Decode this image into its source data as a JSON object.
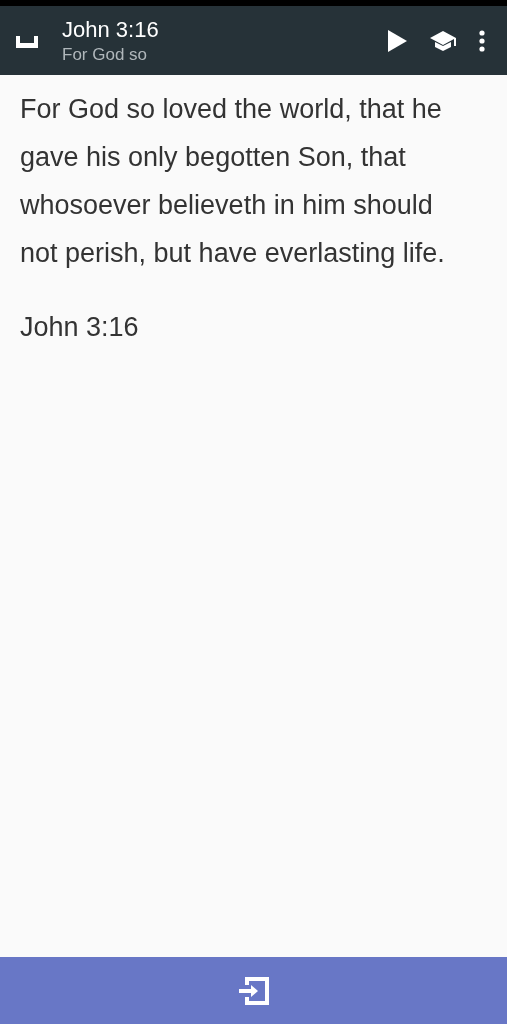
{
  "toolbar": {
    "title": "John 3:16",
    "subtitle": "For God so"
  },
  "verse": {
    "text": "For God so loved the world, that he gave his only begotten Son, that whosoever believeth in him should not perish, but have everlasting life.",
    "reference": "John 3:16"
  }
}
